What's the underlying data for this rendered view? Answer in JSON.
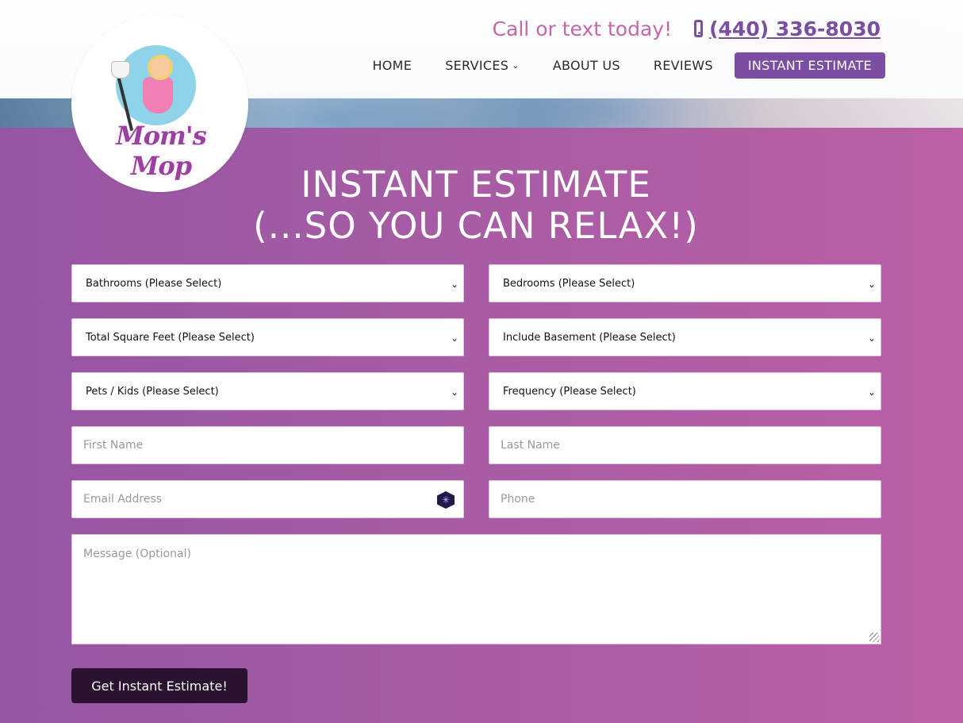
{
  "header": {
    "logo_text": "Mom's Mop",
    "cta": "Call or text today!",
    "phone": "(440) 336-8030"
  },
  "nav": {
    "items": [
      {
        "label": "HOME"
      },
      {
        "label": "SERVICES"
      },
      {
        "label": "ABOUT US"
      },
      {
        "label": "REVIEWS"
      },
      {
        "label": "INSTANT ESTIMATE"
      }
    ]
  },
  "form": {
    "title_line1": "INSTANT ESTIMATE",
    "title_line2": "(...SO YOU CAN RELAX!)",
    "bathrooms": "Bathrooms (Please Select)",
    "bedrooms": "Bedrooms (Please Select)",
    "sqft": "Total Square Feet (Please Select)",
    "basement": "Include Basement (Please Select)",
    "pets": "Pets / Kids (Please Select)",
    "frequency": "Frequency (Please Select)",
    "first_name_placeholder": "First Name",
    "last_name_placeholder": "Last Name",
    "email_placeholder": "Email Address",
    "phone_placeholder": "Phone",
    "message_placeholder": "Message (Optional)",
    "submit_label": "Get Instant Estimate!"
  },
  "colors": {
    "accent": "#7b4ea3",
    "pink": "#c467a9",
    "button_dark": "#2a1230"
  }
}
